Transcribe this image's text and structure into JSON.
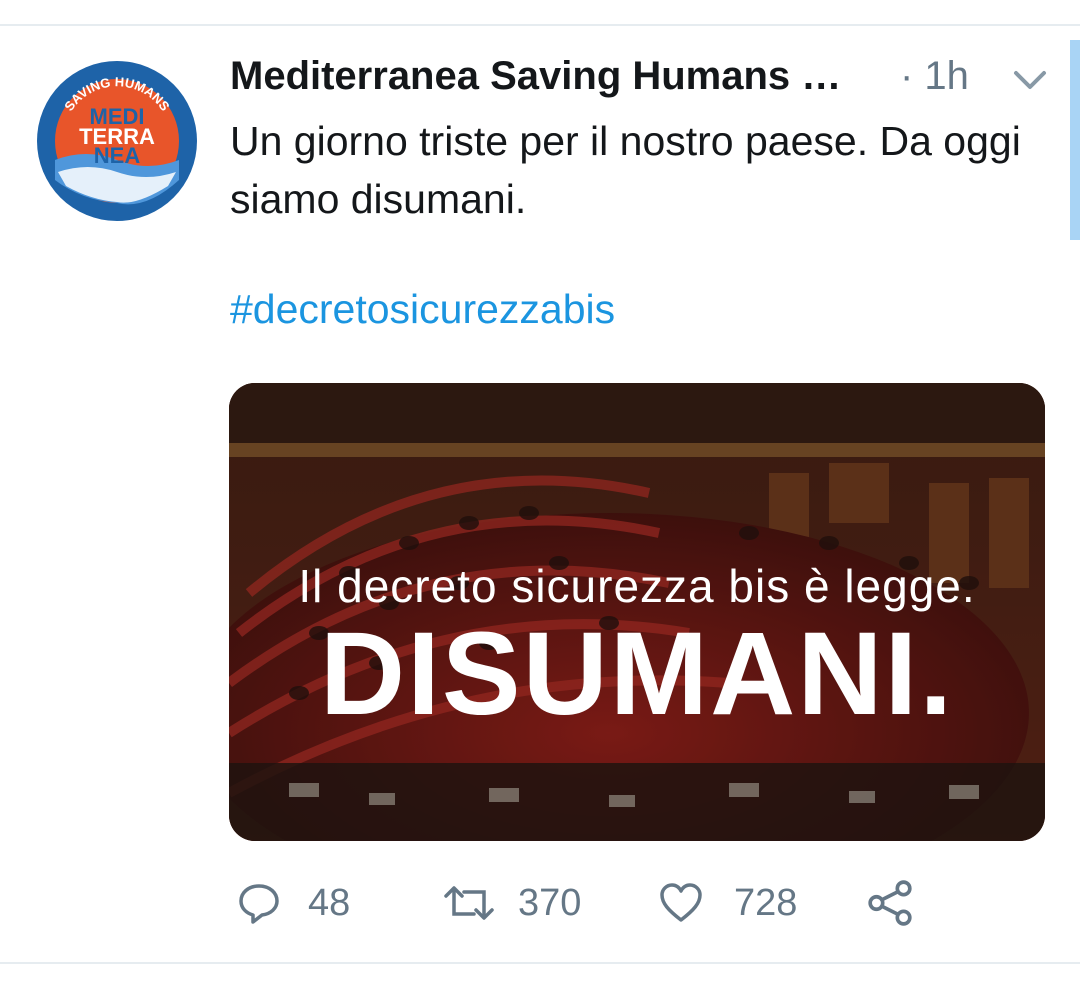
{
  "tweet": {
    "author_name": "Mediterranea Saving Humans …",
    "time": "· 1h",
    "text": "Un giorno triste per il nostro paese. Da oggi siamo disumani.",
    "hashtag": "#decretosicurezzabis"
  },
  "avatar": {
    "ring_text": "SAVING HUMANS",
    "lines": [
      "MEDI",
      "TERRA",
      "NEA"
    ]
  },
  "media": {
    "line1": "Il decreto sicurezza bis è legge.",
    "line2": "DISUMANI."
  },
  "actions": {
    "replies": "48",
    "retweets": "370",
    "likes": "728"
  },
  "icons": [
    "chevron-down-icon",
    "reply-icon",
    "retweet-icon",
    "like-icon",
    "share-icon"
  ],
  "colors": {
    "link": "#1b95e0",
    "secondary": "#657786",
    "brand_orange": "#e8552a",
    "brand_blue": "#1e63a8"
  }
}
